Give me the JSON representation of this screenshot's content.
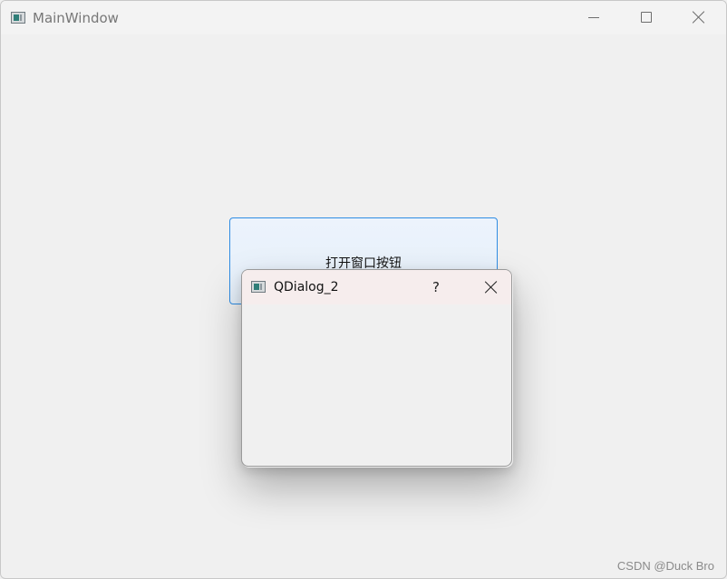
{
  "main_window": {
    "title": "MainWindow",
    "icon": "qt-app-icon",
    "controls": {
      "minimize_icon": "minimize-icon",
      "maximize_icon": "maximize-icon",
      "close_icon": "close-icon"
    }
  },
  "open_button": {
    "label": "打开窗口按钮"
  },
  "dialog": {
    "title": "QDialog_2",
    "icon": "qt-app-icon",
    "help_label": "?",
    "close_icon": "close-icon"
  },
  "watermark": {
    "text": "CSDN @Duck Bro"
  },
  "colors": {
    "button_border": "#2f8de4",
    "button_bg": "#ecf3fc",
    "dialog_titlebar_bg": "#f6eded",
    "window_bg": "#f0f0f0"
  }
}
